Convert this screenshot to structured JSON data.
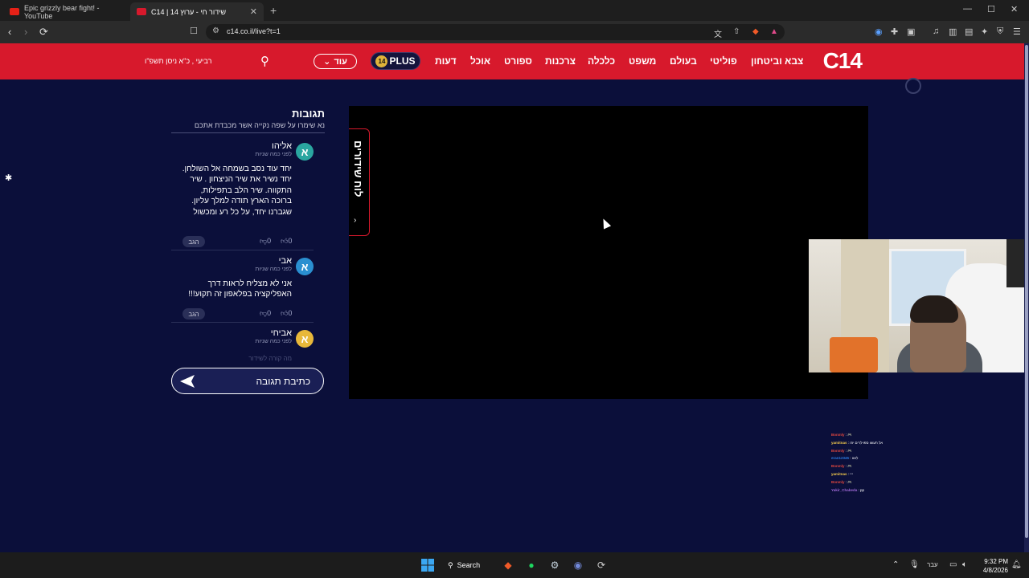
{
  "browser": {
    "tabs": [
      {
        "title": "Epic grizzly bear fight! - YouTube",
        "favicon_color": "#e62117"
      },
      {
        "title": "שידור חי - ערוץ 14 | C14",
        "favicon_color": "#d7192c"
      }
    ],
    "new_tab": "+",
    "url": "c14.co.il/live?t=1",
    "window_controls": [
      "—",
      "☐",
      "✕"
    ]
  },
  "header": {
    "logo": "C14",
    "nav": [
      "צבא וביטחון",
      "פוליטי",
      "בעולם",
      "משפט",
      "כלכלה",
      "צרכנות",
      "ספורט",
      "אוכל",
      "דעות"
    ],
    "plus_badge": "PLUS",
    "plus_num": "14",
    "more_label": "עוד",
    "date": "רביעי , כ\"א ניסן תשפ\"ו",
    "brand_color": "#d7192c"
  },
  "comments": {
    "title": "תגובות",
    "subtitle": "נא שימרו על שפה נקייה אשר מכבדת אתכם",
    "items": [
      {
        "avatar": "א",
        "avatar_color": "#2aa6a0",
        "name": "אליהו",
        "time": "לפני כמה שניות",
        "body": "יחד עוד נסב בשמחה אל השולחן. יחד נשיר את שיר הניצחון . שיר התקווה. שיר הלב בתפילות, ברוכה הארץ תודה למלך עליון. שגברנו יחד, על כל רע ומכשול",
        "likes": "0",
        "dislikes": "0",
        "report": "הגב"
      },
      {
        "avatar": "א",
        "avatar_color": "#2a8fd0",
        "name": "אבי",
        "time": "לפני כמה שניות",
        "body": "אני לא מצליח לראות דרך האפליקציה בפלאפון זה תקוע!!!",
        "likes": "0",
        "dislikes": "0",
        "report": "הגב"
      },
      {
        "avatar": "א",
        "avatar_color": "#e8b83a",
        "name": "אביחי",
        "time": "לפני כמה שניות",
        "body": "",
        "likes": "",
        "dislikes": "",
        "report": ""
      }
    ],
    "fade_text": "מה קורה לשידור",
    "write_label": "כתיבת תגובה"
  },
  "player": {
    "schedule_label": "לוח שידורים",
    "chevron": "›"
  },
  "chat": [
    {
      "user": "Bonmly",
      "msg": ": 🎮",
      "color": "#e0473f"
    },
    {
      "user": "yamitnas",
      "msg": ": אל תעשו ספוילרים יוזו",
      "color": "#f2c94c"
    },
    {
      "user": "Bonmly",
      "msg": ": 🎮",
      "color": "#e0473f"
    },
    {
      "user": "eran12345",
      "msg": ": לאוו",
      "color": "#2d7be0"
    },
    {
      "user": "Bonmly",
      "msg": ": 🎮",
      "color": "#e0473f"
    },
    {
      "user": "yamitnas",
      "msg": ": ייי",
      "color": "#f2c94c"
    },
    {
      "user": "Bonmly",
      "msg": ": 🎮",
      "color": "#e0473f"
    },
    {
      "user": "Yakir_Chabeda",
      "msg": ": pp",
      "color": "#a06ad8"
    }
  ],
  "taskbar": {
    "search_label": "Search",
    "lang": "עבר",
    "time": "9:32 PM",
    "date": "4/8/2026"
  }
}
